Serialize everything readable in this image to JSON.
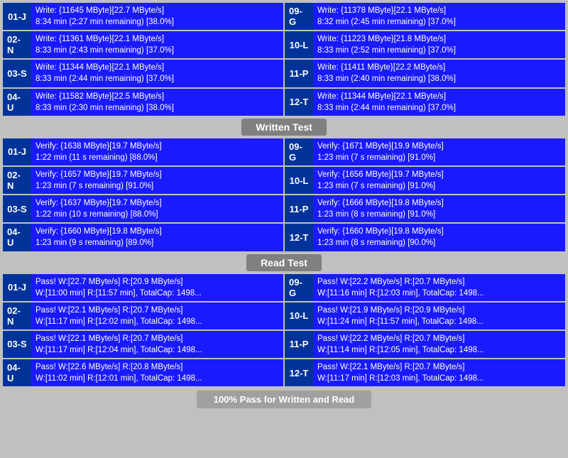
{
  "sections": {
    "written_test": {
      "label": "Written Test",
      "rows_left": [
        {
          "id": "01-J",
          "line1": "Write: {11645 MByte}[22.7 MByte/s]",
          "line2": "8:34 min (2:27 min remaining)  [38.0%]"
        },
        {
          "id": "02-N",
          "line1": "Write: {11361 MByte}[22.1 MByte/s]",
          "line2": "8:33 min (2:43 min remaining)  [37.0%]"
        },
        {
          "id": "03-S",
          "line1": "Write: {11344 MByte}[22.1 MByte/s]",
          "line2": "8:33 min (2:44 min remaining)  [37.0%]"
        },
        {
          "id": "04-U",
          "line1": "Write: {11582 MByte}[22.5 MByte/s]",
          "line2": "8:33 min (2:30 min remaining)  [38.0%]"
        }
      ],
      "rows_right": [
        {
          "id": "09-G",
          "line1": "Write: {11378 MByte}[22.1 MByte/s]",
          "line2": "8:32 min (2:45 min remaining)  [37.0%]"
        },
        {
          "id": "10-L",
          "line1": "Write: {11223 MByte}[21.8 MByte/s]",
          "line2": "8:33 min (2:52 min remaining)  [37.0%]"
        },
        {
          "id": "11-P",
          "line1": "Write: {11411 MByte}[22.2 MByte/s]",
          "line2": "8:33 min (2:40 min remaining)  [38.0%]"
        },
        {
          "id": "12-T",
          "line1": "Write: {11344 MByte}[22.1 MByte/s]",
          "line2": "8:33 min (2:44 min remaining)  [37.0%]"
        }
      ]
    },
    "verify_test": {
      "label": "Written Test",
      "rows_left": [
        {
          "id": "01-J",
          "line1": "Verify: {1638 MByte}[19.7 MByte/s]",
          "line2": "1:22 min (11 s remaining)   [88.0%]"
        },
        {
          "id": "02-N",
          "line1": "Verify: {1657 MByte}[19.7 MByte/s]",
          "line2": "1:23 min (7 s remaining)   [91.0%]"
        },
        {
          "id": "03-S",
          "line1": "Verify: {1637 MByte}[19.7 MByte/s]",
          "line2": "1:22 min (10 s remaining)   [88.0%]"
        },
        {
          "id": "04-U",
          "line1": "Verify: {1660 MByte}[19.8 MByte/s]",
          "line2": "1:23 min (9 s remaining)   [89.0%]"
        }
      ],
      "rows_right": [
        {
          "id": "09-G",
          "line1": "Verify: {1671 MByte}[19.9 MByte/s]",
          "line2": "1:23 min (7 s remaining)   [91.0%]"
        },
        {
          "id": "10-L",
          "line1": "Verify: {1656 MByte}[19.7 MByte/s]",
          "line2": "1:23 min (7 s remaining)   [91.0%]"
        },
        {
          "id": "11-P",
          "line1": "Verify: {1666 MByte}[19.8 MByte/s]",
          "line2": "1:23 min (8 s remaining)   [91.0%]"
        },
        {
          "id": "12-T",
          "line1": "Verify: {1660 MByte}[19.8 MByte/s]",
          "line2": "1:23 min (8 s remaining)   [90.0%]"
        }
      ]
    },
    "read_test": {
      "label": "Read Test",
      "rows_left": [
        {
          "id": "01-J",
          "line1": "Pass! W:[22.7 MByte/s] R:[20.9 MByte/s]",
          "line2": " W:[11:00 min] R:[11:57 min], TotalCap: 1498..."
        },
        {
          "id": "02-N",
          "line1": "Pass! W:[22.1 MByte/s] R:[20.7 MByte/s]",
          "line2": " W:[11:17 min] R:[12:02 min], TotalCap: 1498..."
        },
        {
          "id": "03-S",
          "line1": "Pass! W:[22.1 MByte/s] R:[20.7 MByte/s]",
          "line2": " W:[11:17 min] R:[12:04 min], TotalCap: 1498..."
        },
        {
          "id": "04-U",
          "line1": "Pass! W:[22.6 MByte/s] R:[20.8 MByte/s]",
          "line2": " W:[11:02 min] R:[12:01 min], TotalCap: 1498..."
        }
      ],
      "rows_right": [
        {
          "id": "09-G",
          "line1": "Pass! W:[22.2 MByte/s] R:[20.7 MByte/s]",
          "line2": " W:[11:16 min] R:[12:03 min], TotalCap: 1498..."
        },
        {
          "id": "10-L",
          "line1": "Pass! W:[21.9 MByte/s] R:[20.9 MByte/s]",
          "line2": " W:[11:24 min] R:[11:57 min], TotalCap: 1498..."
        },
        {
          "id": "11-P",
          "line1": "Pass! W:[22.2 MByte/s] R:[20.7 MByte/s]",
          "line2": " W:[11:14 min] R:[12:05 min], TotalCap: 1498..."
        },
        {
          "id": "12-T",
          "line1": "Pass! W:[22.1 MByte/s] R:[20.7 MByte/s]",
          "line2": " W:[11:17 min] R:[12:03 min], TotalCap: 1498..."
        }
      ]
    }
  },
  "dividers": {
    "written_test": "Written Test",
    "read_test": "Read Test",
    "bottom": "100% Pass for Written and Read"
  }
}
